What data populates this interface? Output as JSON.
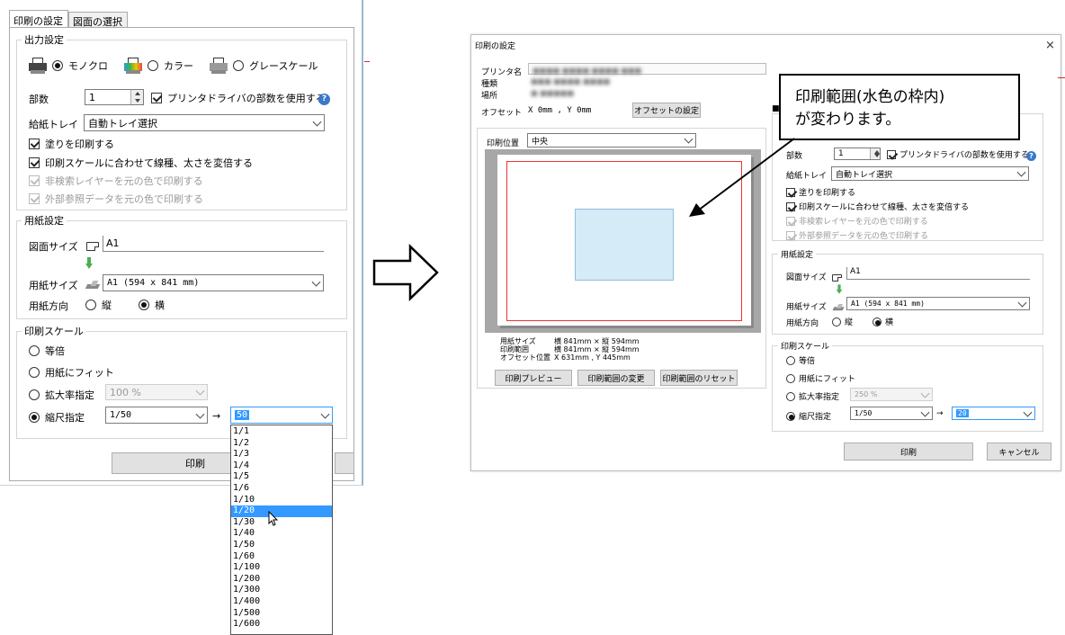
{
  "left": {
    "tabs": [
      "印刷の設定",
      "図面の選択"
    ],
    "output": {
      "title": "出力設定",
      "modes": [
        "モノクロ",
        "カラー",
        "グレースケール"
      ],
      "copies_label": "部数",
      "copies_value": "1",
      "use_driver_copies": "プリンタドライバの部数を使用する",
      "tray_label": "給紙トレイ",
      "tray_value": "自動トレイ選択",
      "opt_fill": "塗りを印刷する",
      "opt_scale_width": "印刷スケールに合わせて線種、太さを変倍する",
      "opt_search_layer": "非検索レイヤーを元の色で印刷する",
      "opt_xref": "外部参照データを元の色で印刷する"
    },
    "paper": {
      "title": "用紙設定",
      "drawing_size_label": "図面サイズ",
      "drawing_size_value": "A1",
      "paper_size_label": "用紙サイズ",
      "paper_size_value": "A1 (594 x 841 mm)",
      "orientation_label": "用紙方向",
      "portrait": "縦",
      "landscape": "横"
    },
    "scale": {
      "title": "印刷スケール",
      "equal": "等倍",
      "fit": "用紙にフィット",
      "zoom_label": "拡大率指定",
      "zoom_value": "100 %",
      "reduce_label": "縮尺指定",
      "reduce_value": "1/50",
      "arrow": "→",
      "target_value": "50"
    },
    "print_button": "印刷",
    "dropdown": [
      "1/1",
      "1/2",
      "1/3",
      "1/4",
      "1/5",
      "1/6",
      "1/10",
      "1/20",
      "1/30",
      "1/40",
      "1/50",
      "1/60",
      "1/100",
      "1/200",
      "1/300",
      "1/400",
      "1/500",
      "1/600"
    ],
    "dropdown_selected": "1/20"
  },
  "right": {
    "window_title": "印刷の設定",
    "close": "×",
    "printer_name_label": "プリンタ名",
    "type_label": "種類",
    "location_label": "場所",
    "offset_label": "オフセット",
    "offset_value": "X 0mm , Y 0mm",
    "offset_button": "オフセットの設定",
    "print_position_label": "印刷位置",
    "print_position_value": "中央",
    "info_labels": [
      "用紙サイズ",
      "印刷範囲",
      "オフセット位置"
    ],
    "info_values": [
      "横 841mm × 縦 594mm",
      "横 841mm × 縦 594mm",
      "X 631mm , Y 445mm"
    ],
    "preview_button": "印刷プレビュー",
    "change_range_button": "印刷範囲の変更",
    "reset_range_button": "印刷範囲のリセット",
    "copies_label": "部数",
    "copies_value": "1",
    "use_driver_copies": "プリンタドライバの部数を使用する",
    "tray_label": "給紙トレイ",
    "tray_value": "自動トレイ選択",
    "opt_fill": "塗りを印刷する",
    "opt_scale_width": "印刷スケールに合わせて線種、太さを変倍する",
    "opt_search_layer": "非検索レイヤーを元の色で印刷する",
    "opt_xref": "外部参照データを元の色で印刷する",
    "paper_title": "用紙設定",
    "drawing_size_label": "図面サイズ",
    "drawing_size_value": "A1",
    "paper_size_label": "用紙サイズ",
    "paper_size_value": "A1 (594 x 841 mm)",
    "orientation_label": "用紙方向",
    "portrait": "縦",
    "landscape": "横",
    "scale_title": "印刷スケール",
    "equal": "等倍",
    "fit": "用紙にフィット",
    "zoom_label": "拡大率指定",
    "zoom_value": "250 %",
    "reduce_label": "縮尺指定",
    "reduce_value": "1/50",
    "arrow": "→",
    "target_value": "20",
    "print_button": "印刷",
    "cancel_button": "キャンセル"
  },
  "callout": {
    "line1": "印刷範囲(水色の枠内)",
    "line2": "が変わります。"
  }
}
